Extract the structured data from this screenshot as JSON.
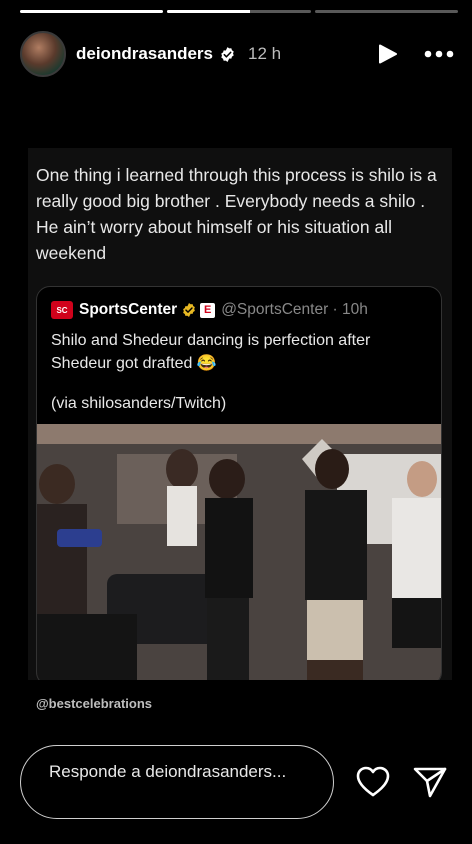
{
  "progress": [
    1,
    0.58,
    0
  ],
  "header": {
    "username": "deiondrasanders",
    "time": "12 h"
  },
  "post": {
    "text": "One thing i learned through this process is shilo is a really good big brother . Everybody needs a shilo . He ain’t worry about himself or his situation all weekend"
  },
  "quote": {
    "logo_text": "SC",
    "name": "SportsCenter",
    "handle": "@SportsCenter · 10h",
    "espn_badge": "E",
    "text": "Shilo and Shedeur dancing is perfection after Shedeur got drafted 😂",
    "via": "(via shilosanders/Twitch)"
  },
  "footer_tag": "@bestcelebrations",
  "reply": {
    "placeholder": "Responde a deiondrasanders..."
  },
  "icons": [
    "verified-icon",
    "play-icon",
    "more-icon",
    "heart-icon",
    "send-icon"
  ]
}
